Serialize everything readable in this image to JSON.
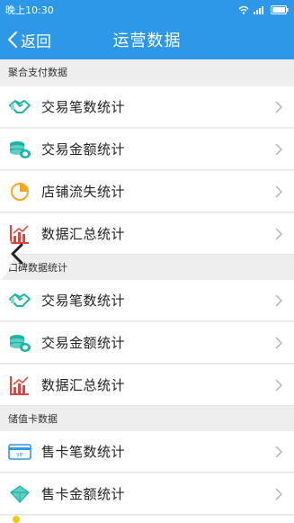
{
  "status_bar": {
    "time": "晚上10:30"
  },
  "nav": {
    "back_label": "返回",
    "title": "运营数据"
  },
  "sections": [
    {
      "header": "聚合支付数据",
      "items": [
        {
          "label": "交易笔数统计",
          "icon": "handshake-icon"
        },
        {
          "label": "交易金额统计",
          "icon": "coins-stack-icon"
        },
        {
          "label": "店铺流失统计",
          "icon": "pie-chart-icon"
        },
        {
          "label": "数据汇总统计",
          "icon": "bar-chart-icon"
        }
      ]
    },
    {
      "header": "口碑数据统计",
      "items": [
        {
          "label": "交易笔数统计",
          "icon": "handshake-icon"
        },
        {
          "label": "交易金额统计",
          "icon": "coins-stack-icon"
        },
        {
          "label": "数据汇总统计",
          "icon": "bar-chart-icon"
        }
      ]
    },
    {
      "header": "储值卡数据",
      "items": [
        {
          "label": "售卡笔数统计",
          "icon": "vip-card-icon"
        },
        {
          "label": "售卡金额统计",
          "icon": "diamond-icon"
        }
      ]
    }
  ],
  "vip_card_text": "VIP",
  "colors": {
    "primary": "#2d98e8",
    "icon_teal": "#1bb5a6",
    "icon_orange": "#f5a623",
    "icon_red": "#e0443e"
  }
}
